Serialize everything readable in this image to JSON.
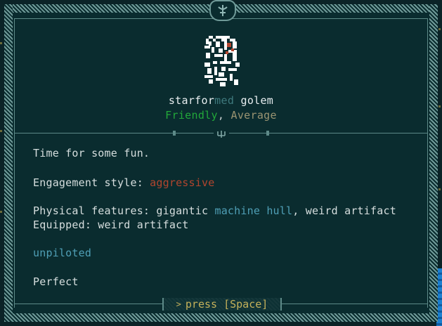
{
  "creature": {
    "name_part1": "starfor",
    "name_part2": "med",
    "name_part3": " golem",
    "attitude": "Friendly",
    "separator": ", ",
    "difficulty": "Average"
  },
  "description": {
    "greeting": "Time for some fun.",
    "engagement_label": "Engagement style: ",
    "engagement_value": "aggressive",
    "physical_label": "Physical features: gigantic ",
    "physical_highlight": "machine hull",
    "physical_rest": ", weird artifact",
    "equipped_line": "Equipped: weird artifact",
    "piloted_status": "unpiloted",
    "condition": "Perfect"
  },
  "prompt": {
    "caret": ">",
    "label": "press [Space]"
  },
  "colors": {
    "friendly": "#22a83a",
    "average": "#9a9472",
    "aggressive": "#b2452e",
    "highlight": "#4f9fb6",
    "prompt": "#c4b15a"
  },
  "icons": [
    "ornament-icon",
    "golem-portrait-icon",
    "trident-ornament-icon"
  ]
}
